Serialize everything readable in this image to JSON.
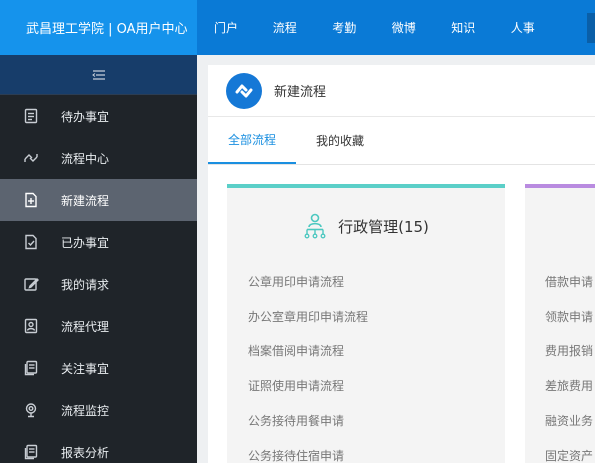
{
  "brand": "武昌理工学院 | OA用户中心",
  "top_nav": [
    "门户",
    "流程",
    "考勤",
    "微博",
    "知识",
    "人事"
  ],
  "sidebar": {
    "items": [
      {
        "label": "待办事宜",
        "icon": "todo-icon"
      },
      {
        "label": "流程中心",
        "icon": "workflow-icon"
      },
      {
        "label": "新建流程",
        "icon": "new-doc-icon",
        "active": true
      },
      {
        "label": "已办事宜",
        "icon": "done-icon"
      },
      {
        "label": "我的请求",
        "icon": "edit-icon"
      },
      {
        "label": "流程代理",
        "icon": "agent-icon"
      },
      {
        "label": "关注事宜",
        "icon": "follow-icon"
      },
      {
        "label": "流程监控",
        "icon": "monitor-icon"
      },
      {
        "label": "报表分析",
        "icon": "report-icon"
      }
    ]
  },
  "header": {
    "title": "新建流程"
  },
  "tabs": [
    {
      "label": "全部流程",
      "active": true
    },
    {
      "label": "我的收藏",
      "active": false
    }
  ],
  "cards": [
    {
      "title": "行政管理(15)",
      "accent": "#5bcfc8",
      "items": [
        "公章用印申请流程",
        "办公室章用印申请流程",
        "档案借阅申请流程",
        "证照使用申请流程",
        "公务接待用餐申请",
        "公务接待住宿申请"
      ]
    },
    {
      "title": "",
      "accent": "#b98be0",
      "items": [
        "借款申请",
        "领款申请",
        "费用报销",
        "差旅费用",
        "融资业务",
        "固定资产"
      ]
    }
  ]
}
